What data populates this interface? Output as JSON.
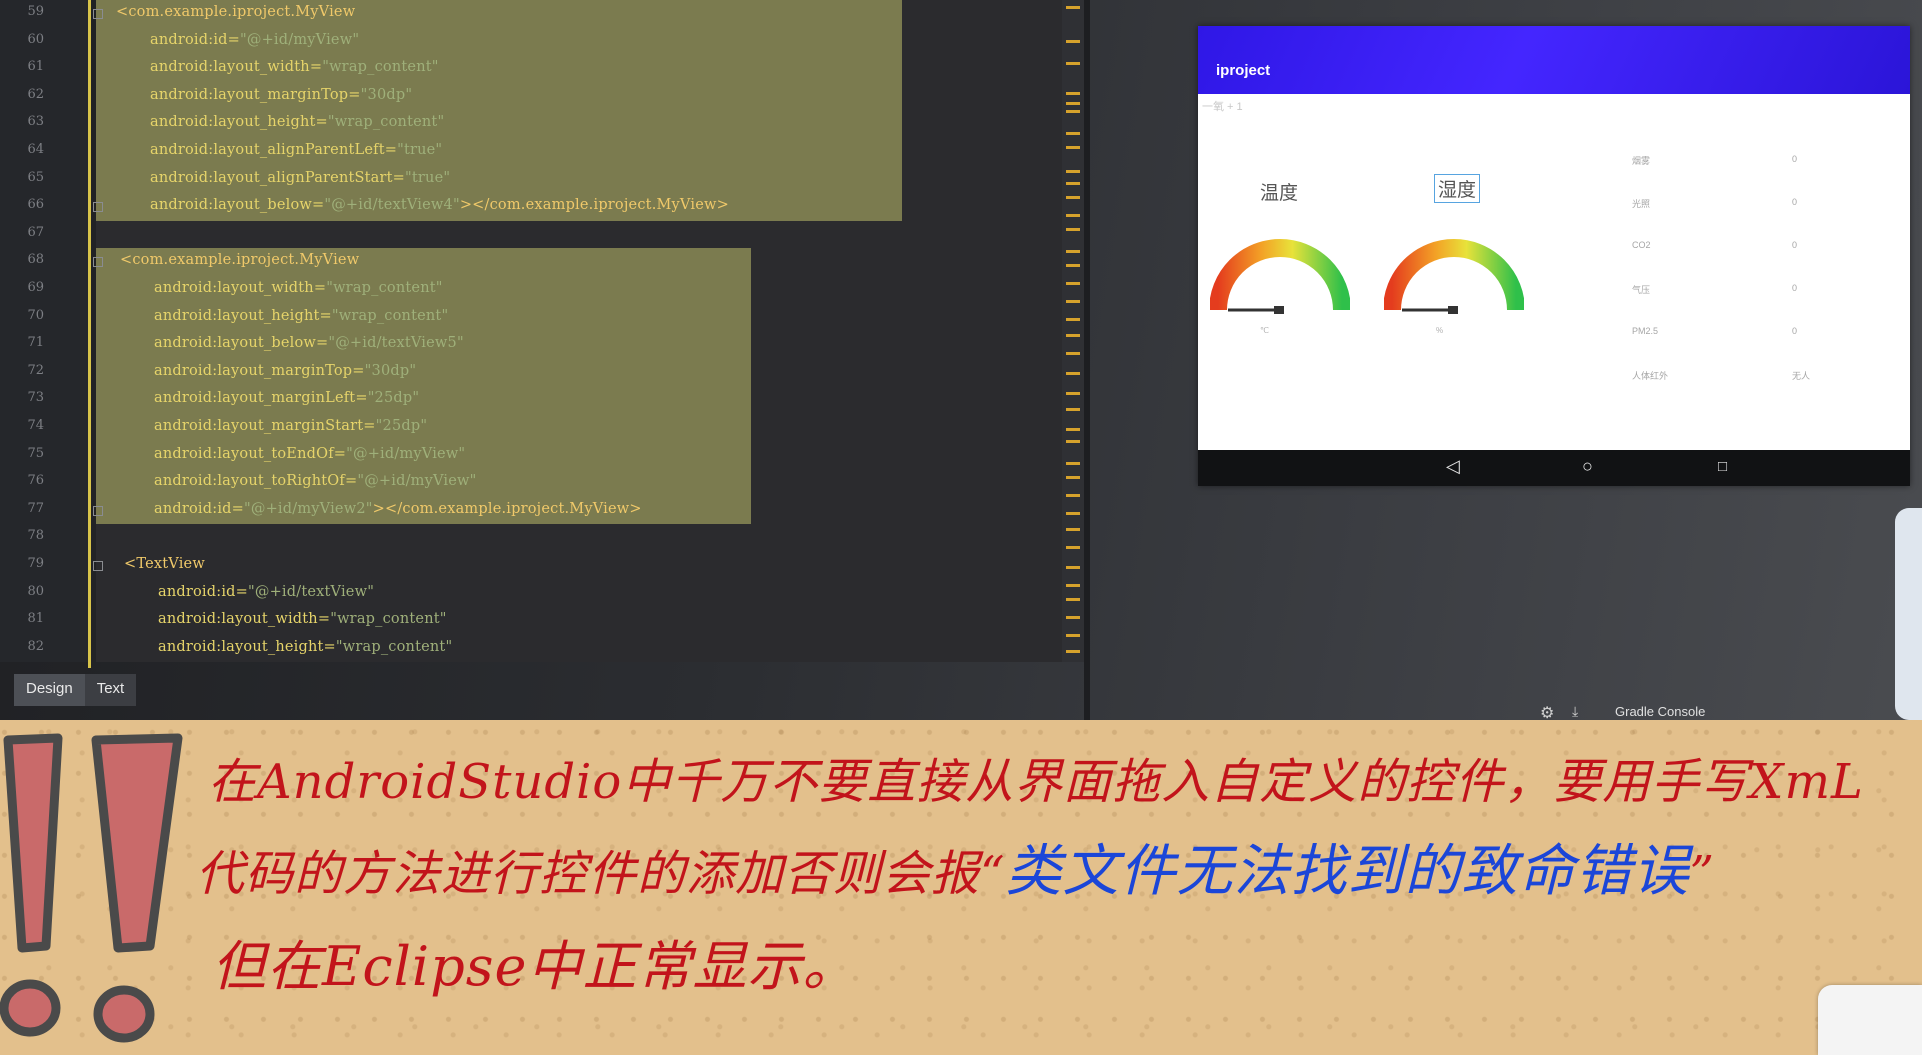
{
  "editor": {
    "line_numbers": [
      "59",
      "60",
      "61",
      "62",
      "63",
      "64",
      "65",
      "66",
      "67",
      "68",
      "69",
      "70",
      "71",
      "72",
      "73",
      "74",
      "75",
      "76",
      "77",
      "78",
      "79",
      "80",
      "81",
      "82"
    ],
    "lines": [
      {
        "tag": "<com.example.iproject.MyView"
      },
      {
        "attr": "android:id=",
        "val": "\"@+id/myView\""
      },
      {
        "attr": "android:layout_width=",
        "val": "\"wrap_content\""
      },
      {
        "attr": "android:layout_marginTop=",
        "val": "\"30dp\""
      },
      {
        "attr": "android:layout_height=",
        "val": "\"wrap_content\""
      },
      {
        "attr": "android:layout_alignParentLeft=",
        "val": "\"true\""
      },
      {
        "attr": "android:layout_alignParentStart=",
        "val": "\"true\""
      },
      {
        "attr": "android:layout_below=",
        "val": "\"@+id/textView4\"",
        "tail": "></com.example.iproject.MyView>"
      },
      {},
      {
        "tag": "<com.example.iproject.MyView"
      },
      {
        "attr": "android:layout_width=",
        "val": "\"wrap_content\""
      },
      {
        "attr": "android:layout_height=",
        "val": "\"wrap_content\""
      },
      {
        "attr": "android:layout_below=",
        "val": "\"@+id/textView5\""
      },
      {
        "attr": "android:layout_marginTop=",
        "val": "\"30dp\""
      },
      {
        "attr": "android:layout_marginLeft=",
        "val": "\"25dp\""
      },
      {
        "attr": "android:layout_marginStart=",
        "val": "\"25dp\""
      },
      {
        "attr": "android:layout_toEndOf=",
        "val": "\"@+id/myView\""
      },
      {
        "attr": "android:layout_toRightOf=",
        "val": "\"@+id/myView\""
      },
      {
        "attr": "android:id=",
        "val": "\"@+id/myView2\"",
        "tail": "></com.example.iproject.MyView>"
      },
      {},
      {
        "tag": "<TextView"
      },
      {
        "attr": "android:id=",
        "val": "\"@+id/textView\""
      },
      {
        "attr": "android:layout_width=",
        "val": "\"wrap_content\""
      },
      {
        "attr": "android:layout_height=",
        "val": "\"wrap_content\""
      }
    ],
    "tabs": [
      "Design",
      "Text"
    ],
    "active_tab": "Design",
    "gradle_console": "Gradle Console"
  },
  "device": {
    "app_title": "iproject",
    "subtitle": "一氧 + 1",
    "gauges": [
      {
        "label": "温度",
        "unit": "℃",
        "value_fraction": 0.0
      },
      {
        "label": "湿度",
        "unit": "%",
        "value_fraction": 0.0
      }
    ],
    "readings": [
      {
        "label": "烟雾",
        "value": "0"
      },
      {
        "label": "光照",
        "value": "0"
      },
      {
        "label": "CO2",
        "value": "0"
      },
      {
        "label": "气压",
        "value": "0"
      },
      {
        "label": "PM2.5",
        "value": "0"
      },
      {
        "label": "人体红外",
        "value": "无人"
      }
    ],
    "nav_icons": [
      "back-icon",
      "home-icon",
      "recents-icon"
    ]
  },
  "note": {
    "line1": "在AndroidStudio中千万不要直接从界面拖入自定义的控件，要用手写XmL",
    "line2_red": "代码的方法进行控件的添加否则会报“",
    "line2_blue": "类文件无法找到的致命错误",
    "line2_end": "”",
    "line3": "但在Eclipse中正常显示。",
    "colors": {
      "red": "#c2141b",
      "blue": "#1b46d8",
      "paper": "#e3c08c"
    }
  }
}
